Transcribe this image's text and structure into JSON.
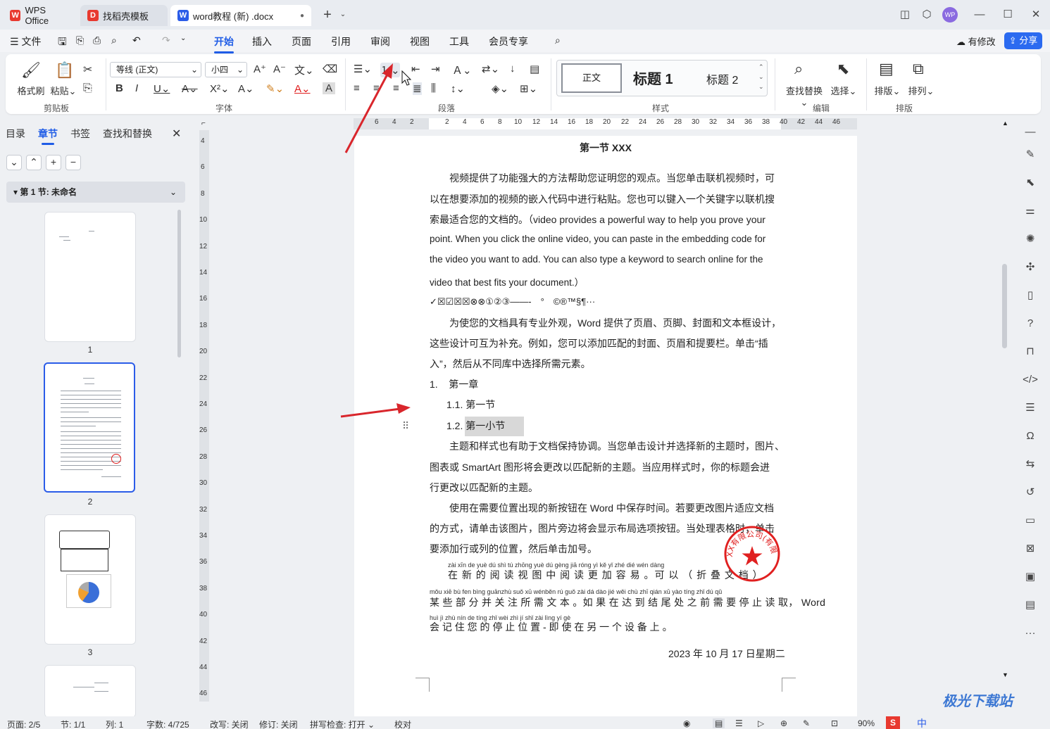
{
  "titlebar": {
    "tabs": [
      {
        "label": "WPS Office",
        "icon": "wps-logo-icon"
      },
      {
        "label": "找稻壳模板",
        "icon": "docer-icon"
      },
      {
        "label": "word教程 (新) .docx",
        "icon": "word-doc-icon",
        "active": true
      }
    ],
    "new_tab": "+",
    "avatar": "WP"
  },
  "menubar": {
    "file": "文件",
    "items": [
      "开始",
      "插入",
      "页面",
      "引用",
      "审阅",
      "视图",
      "工具",
      "会员专享"
    ],
    "active": "开始",
    "modify": "有修改",
    "share": "分享"
  },
  "ribbon": {
    "clipboard": {
      "label": "剪贴板",
      "format_painter": "格式刷",
      "paste": "粘贴"
    },
    "font": {
      "label": "字体",
      "family": "等线 (正文)",
      "size": "小四"
    },
    "paragraph": {
      "label": "段落"
    },
    "styles": {
      "label": "样式",
      "normal": "正文",
      "h1": "标题  1",
      "h2": "标题  2"
    },
    "edit": {
      "label": "编辑",
      "find_replace": "查找替换",
      "select": "选择"
    },
    "arrange": {
      "label": "排版",
      "layout": "排版",
      "order": "排列"
    }
  },
  "leftpanel": {
    "tabs": [
      "目录",
      "章节",
      "书签",
      "查找和替换"
    ],
    "active": "章节",
    "section": "第 1 节: 未命名",
    "pages": [
      "1",
      "2",
      "3"
    ]
  },
  "ruler": {
    "h": [
      "6",
      "4",
      "2",
      "2",
      "4",
      "6",
      "8",
      "10",
      "12",
      "14",
      "16",
      "18",
      "20",
      "22",
      "24",
      "26",
      "28",
      "30",
      "32",
      "34",
      "36",
      "38",
      "40",
      "42",
      "44",
      "46"
    ],
    "v": [
      "4",
      "6",
      "8",
      "10",
      "12",
      "14",
      "16",
      "18",
      "20",
      "22",
      "24",
      "26",
      "28",
      "30",
      "32",
      "34",
      "36",
      "38",
      "40",
      "42",
      "44",
      "46"
    ]
  },
  "document": {
    "heading": "第一节 XXX",
    "p1": [
      "　　视频提供了功能强大的方法帮助您证明您的观点。当您单击联机视频时，可",
      "以在想要添加的视频的嵌入代码中进行粘贴。您也可以键入一个关键字以联机搜",
      "索最适合您的文档的。（video provides a powerful way to help you prove your",
      "point. When you click the online video, you can paste in the embedding code for",
      "the video you want to add. You can also type a keyword to search online for the",
      "video that best fits your document.）"
    ],
    "symbols": "✓☒☑☒☒⊗⊗①②③——-　°　©®™§¶···",
    "p2": [
      "　　为使您的文档具有专业外观，Word 提供了页眉、页脚、封面和文本框设计，",
      "这些设计可互为补充。例如，您可以添加匹配的封面、页眉和提要栏。单击“插",
      "入”，然后从不同库中选择所需元素。"
    ],
    "list": [
      {
        "num": "1.",
        "text": "第一章"
      },
      {
        "num": "1.1.",
        "text": "第一节"
      },
      {
        "num": "1.2.",
        "text": "第一小节"
      }
    ],
    "p3": [
      "　　主题和样式也有助于文档保持协调。当您单击设计并选择新的主题时，图片、",
      "图表或 SmartArt 图形将会更改以匹配新的主题。当应用样式时，你的标题会进",
      "行更改以匹配新的主题。"
    ],
    "p4": [
      "　　使用在需要位置出现的新按钮在 Word 中保存时间。若要更改图片适应文档",
      "的方式，请单击该图片，图片旁边将会显示布局选项按钮。当处理表格时，单击",
      "要添加行或列的位置，然后单击加号。"
    ],
    "pinyin1": "zài  xīn   de  yuè  dú   shì   tú   zhōng  yuè  dú  gèng  jiā  róng  yì         kě    yǐ            zhé  dié  wén  dàng",
    "line1": "在 新 的 阅 读 视 图 中 阅 读 更 加 容 易 。可 以 （ 折 叠 文 档 ）",
    "pinyin2": "mǒu xiē  bù  fen bìng guānzhù suǒ  xū  wénběn       rú  guǒ  zài  dá  dào  jié  wěi  chù  zhī qián  xū  yào  tíng  zhǐ  dú   qǔ",
    "line2": "某 些 部 分 并 关 注 所 需 文 本 。如 果 在 达 到 结 尾 处 之 前 需 要 停 止 读 取，  Word",
    "pinyin3": "huì   jì    zhù  nín   de  tíng zhǐ  wèi zhì          jí   shǐ  zài  lìng  yí   gè",
    "line3": "会 记 住 您 的 停 止 位 置  -  即 使 在 另 一 个 设 备 上 。",
    "date": "2023 年 10 月 17 日星期二",
    "seal_text": "广州XX有限公司(有限合伙)"
  },
  "status": {
    "page": "页面: 2/5",
    "section": "节: 1/1",
    "col": "列: 1",
    "words": "字数: 4/725",
    "rewrite": "改写: 关闭",
    "revise": "修订: 关闭",
    "spell": "拼写检查: 打开",
    "proof": "校对",
    "zoom": "90%"
  },
  "watermark": "极光下载站",
  "colors": {
    "accent": "#1f5ce6",
    "arrow": "#d9262c",
    "seal": "#e02020"
  }
}
